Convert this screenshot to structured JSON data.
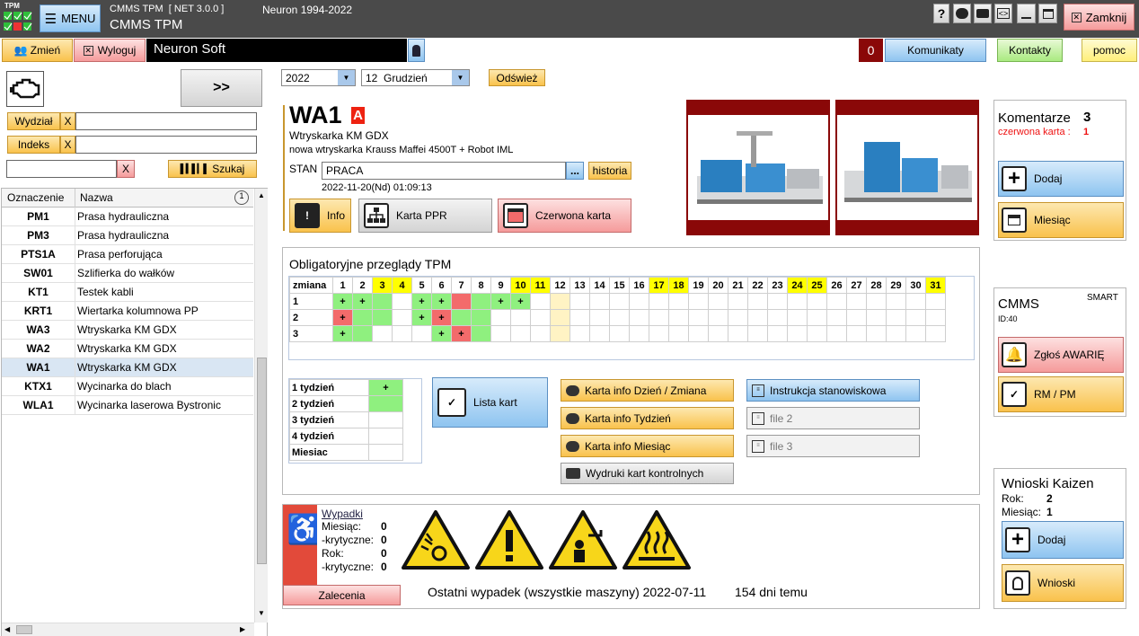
{
  "app": {
    "logo_text": "TPM",
    "menu_label": "MENU",
    "title_small": "CMMS TPM  [ NET 3.0.0 ]",
    "title_big": "CMMS TPM",
    "copyright": "Neuron 1994-2022",
    "close_label": "Zamknij"
  },
  "toolbar": {
    "change_label": "Zmień",
    "logout_label": "Wyloguj",
    "user_name": "Neuron Soft",
    "messages_count": "0",
    "messages_label": "Komunikaty",
    "contacts_label": "Kontakty",
    "help_label": "pomoc"
  },
  "left": {
    "next_label": ">>",
    "department_label": "Wydział",
    "department_clear": "X",
    "index_label": "Indeks",
    "index_clear": "X",
    "search_clear": "X",
    "search_label": "Szukaj",
    "col_code": "Oznaczenie",
    "col_name": "Nazwa",
    "rows": [
      [
        "PM1",
        "Prasa hydrauliczna"
      ],
      [
        "PM3",
        "Prasa hydrauliczna"
      ],
      [
        "PTS1A",
        "Prasa perforująca"
      ],
      [
        "SW01",
        "Szlifierka do wałków"
      ],
      [
        "KT1",
        "Testek kabli"
      ],
      [
        "KRT1",
        "Wiertarka kolumnowa PP"
      ],
      [
        "WA3",
        "Wtryskarka KM GDX"
      ],
      [
        "WA2",
        "Wtryskarka KM GDX"
      ],
      [
        "WA1",
        "Wtryskarka KM GDX"
      ],
      [
        "KTX1",
        "Wycinarka do blach"
      ],
      [
        "WLA1",
        "Wycinarka laserowa Bystronic"
      ]
    ],
    "selected_index": 8
  },
  "filter": {
    "year": "2022",
    "month": "12  Grudzień",
    "refresh_label": "Odśwież"
  },
  "machine": {
    "code": "WA1",
    "class": "A",
    "type": "Wtryskarka KM GDX",
    "description": "nowa wtryskarka Krauss Maffei 4500T + Robot IML",
    "status_label": "STAN",
    "status_value": "PRACA",
    "dots_label": "...",
    "history_label": "historia",
    "status_date": "2022-11-20(Nd) 01:09:13",
    "info_label": "Info",
    "ppr_label": "Karta PPR",
    "red_card_label": "Czerwona karta"
  },
  "comments": {
    "title": "Komentarze",
    "count": "3",
    "red_card_label": "czerwona karta :",
    "red_card_count": "1",
    "add_label": "Dodaj",
    "month_label": "Miesiąc"
  },
  "cmms": {
    "title": "CMMS",
    "smart": "SMART",
    "id": "ID:40",
    "failure_label": "Zgłoś AWARIĘ",
    "rm_label": "RM / PM"
  },
  "kaizen": {
    "title": "Wnioski Kaizen",
    "year_label": "Rok:",
    "year_value": "2",
    "month_label": "Miesiąc:",
    "month_value": "1",
    "add_label": "Dodaj",
    "list_label": "Wnioski"
  },
  "tpm": {
    "title": "Obligatoryjne przeglądy TPM",
    "shift_label": "zmiana",
    "days": [
      "1",
      "2",
      "3",
      "4",
      "5",
      "6",
      "7",
      "8",
      "9",
      "10",
      "11",
      "12",
      "13",
      "14",
      "15",
      "16",
      "17",
      "18",
      "19",
      "20",
      "21",
      "22",
      "23",
      "24",
      "25",
      "26",
      "27",
      "28",
      "29",
      "30",
      "31"
    ],
    "weekend_days": [
      3,
      4,
      10,
      11,
      17,
      18,
      24,
      25,
      31
    ],
    "today": 12,
    "shifts": [
      {
        "name": "1",
        "cells": {
          "1": [
            "g",
            "+"
          ],
          "2": [
            "g",
            "+"
          ],
          "3": [
            "g",
            ""
          ],
          "5": [
            "g",
            "+"
          ],
          "6": [
            "g",
            "+"
          ],
          "7": [
            "r",
            ""
          ],
          "8": [
            "g",
            ""
          ],
          "9": [
            "g",
            "+"
          ],
          "10": [
            "g",
            "+"
          ]
        }
      },
      {
        "name": "2",
        "cells": {
          "1": [
            "r",
            "+"
          ],
          "2": [
            "g",
            ""
          ],
          "3": [
            "g",
            ""
          ],
          "5": [
            "g",
            "+"
          ],
          "6": [
            "r",
            "+"
          ],
          "7": [
            "g",
            ""
          ],
          "8": [
            "g",
            ""
          ]
        }
      },
      {
        "name": "3",
        "cells": {
          "1": [
            "g",
            "+"
          ],
          "2": [
            "g",
            ""
          ],
          "6": [
            "g",
            "+"
          ],
          "7": [
            "r",
            "+"
          ],
          "8": [
            "g",
            ""
          ]
        }
      }
    ],
    "weeks": [
      [
        "1 tydzień",
        "+"
      ],
      [
        "2 tydzień",
        ""
      ],
      [
        "3 tydzień",
        ""
      ],
      [
        "4 tydzień",
        ""
      ],
      [
        "Miesiac",
        ""
      ]
    ],
    "list_cards_label": "Lista kart",
    "card_buttons": [
      "Karta info Dzień / Zmiana",
      "Karta info Tydzień",
      "Karta info Miesiąc"
    ],
    "print_label": "Wydruki kart kontrolnych",
    "files": [
      "Instrukcja stanowiskowa",
      "file 2",
      "file 3"
    ]
  },
  "accidents": {
    "title": "Wypadki",
    "rows": [
      [
        "Miesiąc:",
        "0"
      ],
      [
        "-krytyczne:",
        "0"
      ],
      [
        "Rok:",
        "0"
      ],
      [
        "-krytyczne:",
        "0"
      ]
    ],
    "recommend_label": "Zalecenia",
    "last_label": "Ostatni wypadek (wszystkie maszyny) 2022-07-11",
    "days_ago": "154 dni temu"
  },
  "colors": {
    "green": "#8ff07f",
    "red": "#f36b6b",
    "weekend": "#ffff00",
    "today": "#fff3c4",
    "dark_red": "#8a0808"
  }
}
